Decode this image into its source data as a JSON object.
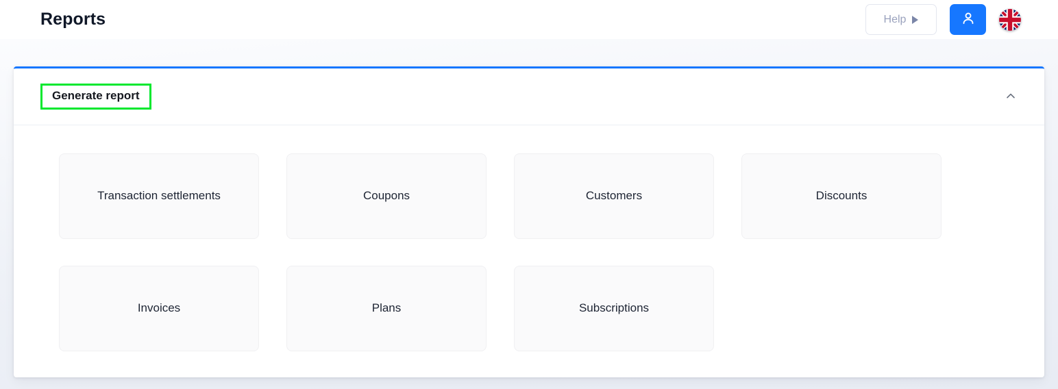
{
  "header": {
    "title": "Reports",
    "help_label": "Help",
    "help_caret_icon": "triangle-right-icon",
    "user_icon": "user-avatar-icon",
    "flag_icon": "uk-flag-icon",
    "accent_color": "#1677ff"
  },
  "panel": {
    "title": "Generate report",
    "highlight_color": "#00e82e",
    "accent_top_border": "#1677ff",
    "collapse_icon": "chevron-up-icon",
    "cards": [
      {
        "label": "Transaction settlements"
      },
      {
        "label": "Coupons"
      },
      {
        "label": "Customers"
      },
      {
        "label": "Discounts"
      },
      {
        "label": "Invoices"
      },
      {
        "label": "Plans"
      },
      {
        "label": "Subscriptions"
      }
    ]
  }
}
